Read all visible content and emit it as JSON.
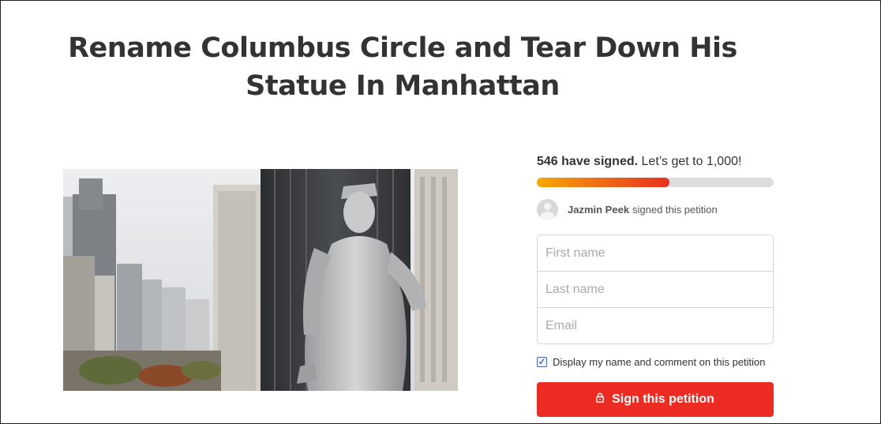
{
  "petition": {
    "title": "Rename Columbus Circle and Tear Down His Statue In Manhattan",
    "image_alt": "Columbus statue at Columbus Circle, Manhattan"
  },
  "signatures": {
    "count_text": "546 have signed.",
    "goal_text": "Let’s get to 1,000!",
    "progress_fraction": 0.56,
    "colors": {
      "fill_start": "#f6a800",
      "fill_end": "#e7301f",
      "track": "#dcdcdc"
    }
  },
  "recent_signer": {
    "name": "Jazmin Peek",
    "action": "signed this petition",
    "avatar_icon": "user-avatar-icon"
  },
  "form": {
    "first_name_placeholder": "First name",
    "last_name_placeholder": "Last name",
    "email_placeholder": "Email",
    "display_checkbox_label": "Display my name and comment on this petition",
    "display_checked": true,
    "submit_label": "Sign this petition",
    "submit_icon": "lock-icon",
    "submit_color": "#ec2c22"
  }
}
